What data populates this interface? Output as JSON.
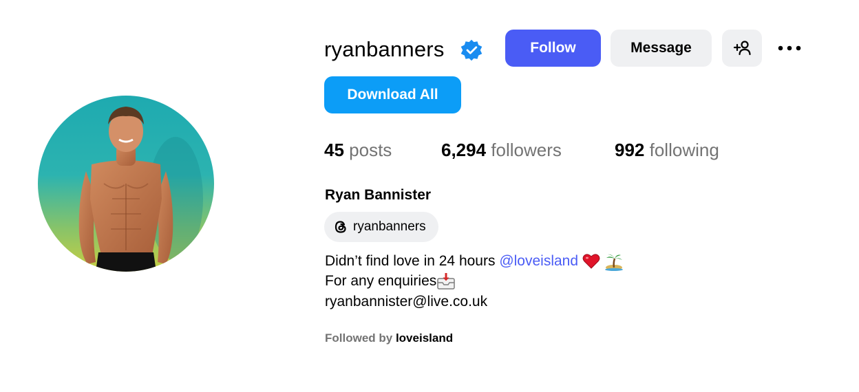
{
  "profile": {
    "username": "ryanbanners",
    "verified": true,
    "full_name": "Ryan Bannister"
  },
  "actions": {
    "follow_label": "Follow",
    "message_label": "Message",
    "download_label": "Download All",
    "add_user_icon": "person-add-icon",
    "more_icon": "more-horizontal-icon"
  },
  "stats": {
    "posts_count": "45",
    "posts_label": "posts",
    "followers_count": "6,294",
    "followers_label": "followers",
    "following_count": "992",
    "following_label": "following"
  },
  "threads": {
    "icon": "threads-icon",
    "handle": "ryanbanners"
  },
  "bio": {
    "line1_text": "Didn’t find love in 24 hours ",
    "line1_mention": "@loveisland",
    "line1_emojis": [
      "heart-emoji",
      "island-emoji"
    ],
    "line2_text": "For any enquiries",
    "line2_emoji": "inbox-tray-emoji",
    "line3_text": "ryanbannister@live.co.uk"
  },
  "followed_by": {
    "prefix": "Followed by ",
    "user": "loveisland"
  },
  "colors": {
    "follow_bg": "#4a5cf5",
    "download_bg": "#0c9df7",
    "verified_badge": "#1a8cf0",
    "secondary_button_bg": "#eff0f2",
    "muted_text": "#737373",
    "mention": "#4a5cf5"
  }
}
